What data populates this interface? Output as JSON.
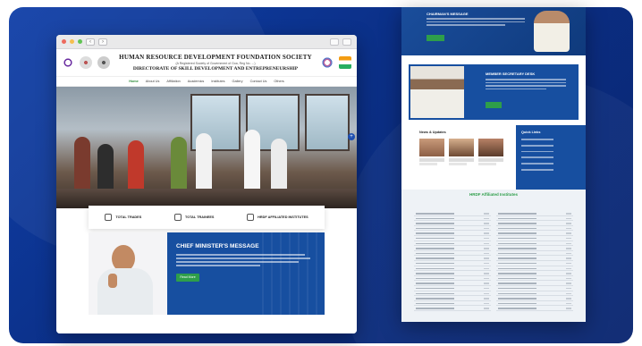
{
  "colors": {
    "background": "#0b2f86",
    "accent_green": "#2e9e4a",
    "panel_blue": "#174fa0"
  },
  "browser": {
    "header": {
      "title": "HUMAN RESOURCE DEVELOPMENT FOUNDATION SOCIETY",
      "subtitle": "(A Registered Society of Government of Goa, Reg No. ...)",
      "directorate": "DIRECTORATE OF SKILL DEVELOPMENT AND ENTREPRENEURSHIP"
    },
    "menu": [
      "Home",
      "About Us",
      "Affiliation",
      "Academics",
      "Institutes",
      "Gallery",
      "Contact Us",
      "Others"
    ],
    "stats": [
      {
        "label": "TOTAL TRADES",
        "icon": "graduation-cap-icon"
      },
      {
        "label": "TOTAL TRAINEES",
        "icon": "building-icon"
      },
      {
        "label": "HRDF AFFILIATED INSTITUTES",
        "icon": "handshake-icon"
      }
    ],
    "chief_minister": {
      "title": "CHIEF MINISTER'S MESSAGE",
      "button": "Read More"
    }
  },
  "longpage": {
    "chairman_title": "CHAIRMAN'S MESSAGE",
    "member_secretary_title": "MEMBER SECRETARY DESK",
    "news_title": "News & Updates",
    "quick_links_title": "Quick Links",
    "institutes_title": "HRDF Affiliated Institutes"
  }
}
